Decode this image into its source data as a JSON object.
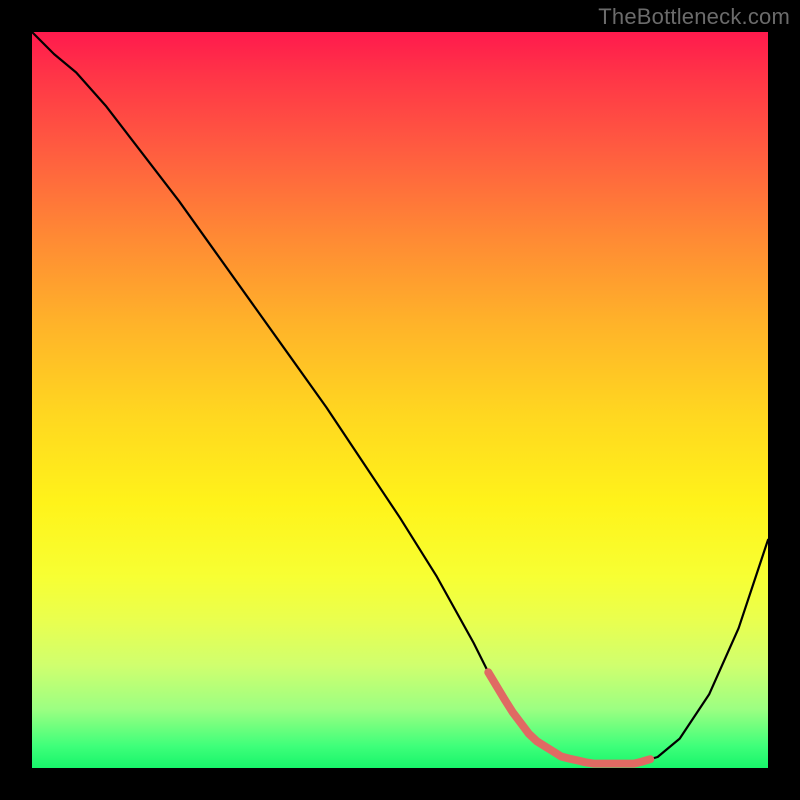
{
  "watermark": "TheBottleneck.com",
  "chart_data": {
    "type": "line",
    "title": "",
    "xlabel": "",
    "ylabel": "",
    "xlim": [
      0,
      100
    ],
    "ylim": [
      0,
      100
    ],
    "series": [
      {
        "name": "curve",
        "x": [
          0,
          3,
          6,
          10,
          15,
          20,
          25,
          30,
          35,
          40,
          45,
          50,
          55,
          60,
          62,
          65,
          68,
          72,
          76,
          80,
          82,
          85,
          88,
          92,
          96,
          100
        ],
        "values": [
          100,
          97,
          94.5,
          90,
          83.5,
          77,
          70,
          63,
          56,
          49,
          41.5,
          34,
          26,
          17,
          13,
          8,
          4,
          1.5,
          0.6,
          0.5,
          0.6,
          1.5,
          4,
          10,
          19,
          31
        ]
      }
    ],
    "valley_band": {
      "x_start": 62,
      "x_end": 84,
      "y": 0.6,
      "color": "#e06a63"
    }
  }
}
